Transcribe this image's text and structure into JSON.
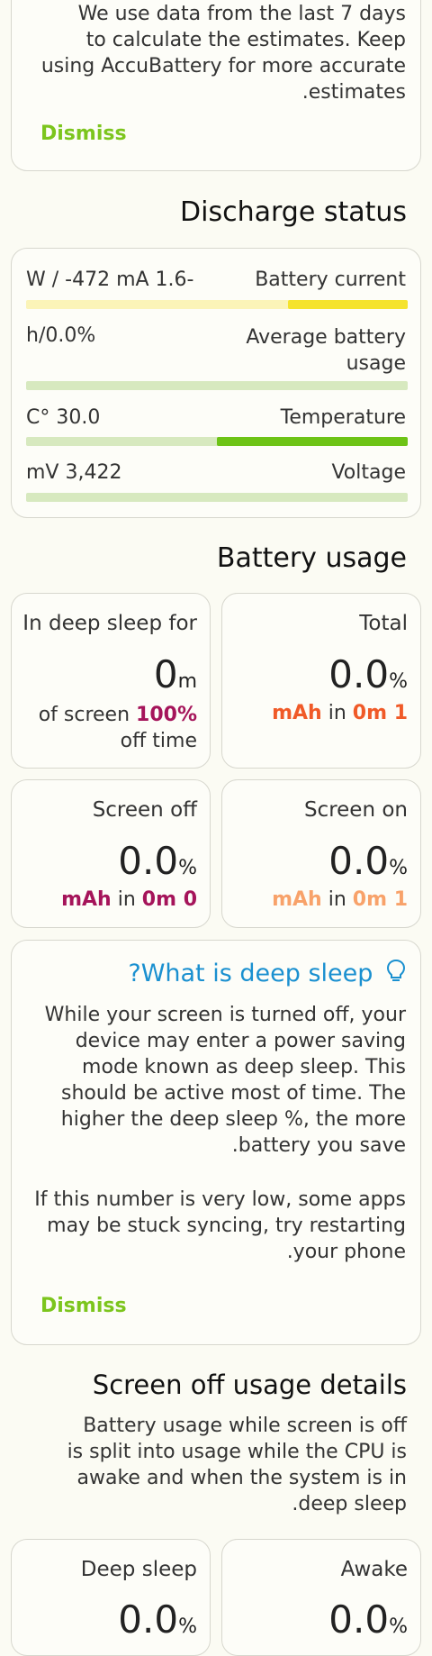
{
  "intro_card": {
    "text_lines": [
      "We use data from the last 7 days",
      "to calculate the estimates. Keep",
      "using AccuBattery for more accurate",
      ".estimates"
    ],
    "dismiss_label": "Dismiss"
  },
  "discharge_status": {
    "title": "Discharge status",
    "rows": [
      {
        "value": "W / -472 mA 1.6-",
        "label": "Battery current"
      },
      {
        "value": "h/0.0%",
        "label_line1": "Average battery",
        "label_line2": "usage"
      },
      {
        "value": "C° 30.0",
        "label": "Temperature"
      },
      {
        "value": "mV 3,422",
        "label": "Voltage"
      }
    ],
    "colors": {
      "current_bar": "#fbf4b8",
      "current_fill": "#f5e32d",
      "green_bar": "#d7e9bf",
      "green_fill": "#6dc316"
    }
  },
  "battery_usage": {
    "title": "Battery usage",
    "deep_sleep": {
      "label": "In deep sleep for",
      "value": "0",
      "unit": "m",
      "sub_prefix": "of screen",
      "sub_pct": "100%",
      "sub_line2": "off time"
    },
    "total": {
      "label": "Total",
      "value": "0.0",
      "unit": "%",
      "mah": "mAh",
      "in": "in",
      "time": "0m 1"
    },
    "screen_off": {
      "label": "Screen off",
      "value": "0.0",
      "unit": "%",
      "mah": "mAh",
      "in": "in",
      "time": "0m 0"
    },
    "screen_on": {
      "label": "Screen on",
      "value": "0.0",
      "unit": "%",
      "mah": "mAh",
      "in": "in",
      "time": "0m 1"
    },
    "colors": {
      "total": "#f05a28",
      "screen_off": "#a5145a",
      "screen_on": "#f8a26a",
      "deep_sleep_pct": "#a5145a"
    }
  },
  "deep_sleep_card": {
    "title": "?What is deep sleep",
    "icon": "lightbulb-icon",
    "para1_lines": [
      "While your screen is turned off, your",
      "device may enter a power saving",
      "mode known as deep sleep. This",
      "should be active most of time. The",
      "higher the deep sleep %, the more",
      ".battery you save"
    ],
    "para2_lines": [
      "If this number is very low, some apps",
      "may be stuck syncing, try restarting",
      ".your phone"
    ],
    "dismiss_label": "Dismiss",
    "accent": "#1a90d0"
  },
  "screen_off_details": {
    "title": "Screen off usage details",
    "desc_lines": [
      "Battery usage while screen is off",
      "is split into usage while the CPU is",
      "awake and when the system is in",
      ".deep sleep"
    ],
    "deep_sleep": {
      "label": "Deep sleep",
      "value": "0.0",
      "unit": "%"
    },
    "awake": {
      "label": "Awake",
      "value": "0.0",
      "unit": "%"
    }
  }
}
